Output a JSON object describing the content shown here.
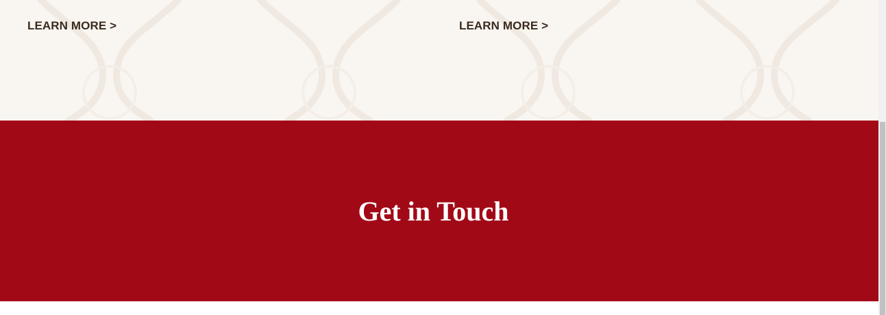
{
  "features": {
    "left_link_label": "LEARN MORE >",
    "right_link_label": "LEARN MORE >"
  },
  "contact": {
    "title": "Get in Touch"
  },
  "colors": {
    "cream_background": "#f9f6f1",
    "brand_red": "#a20917",
    "link_text": "#3a2a1f",
    "title_text": "#ffffff"
  },
  "icons": {
    "background_pattern": "rope-knot-pattern"
  }
}
